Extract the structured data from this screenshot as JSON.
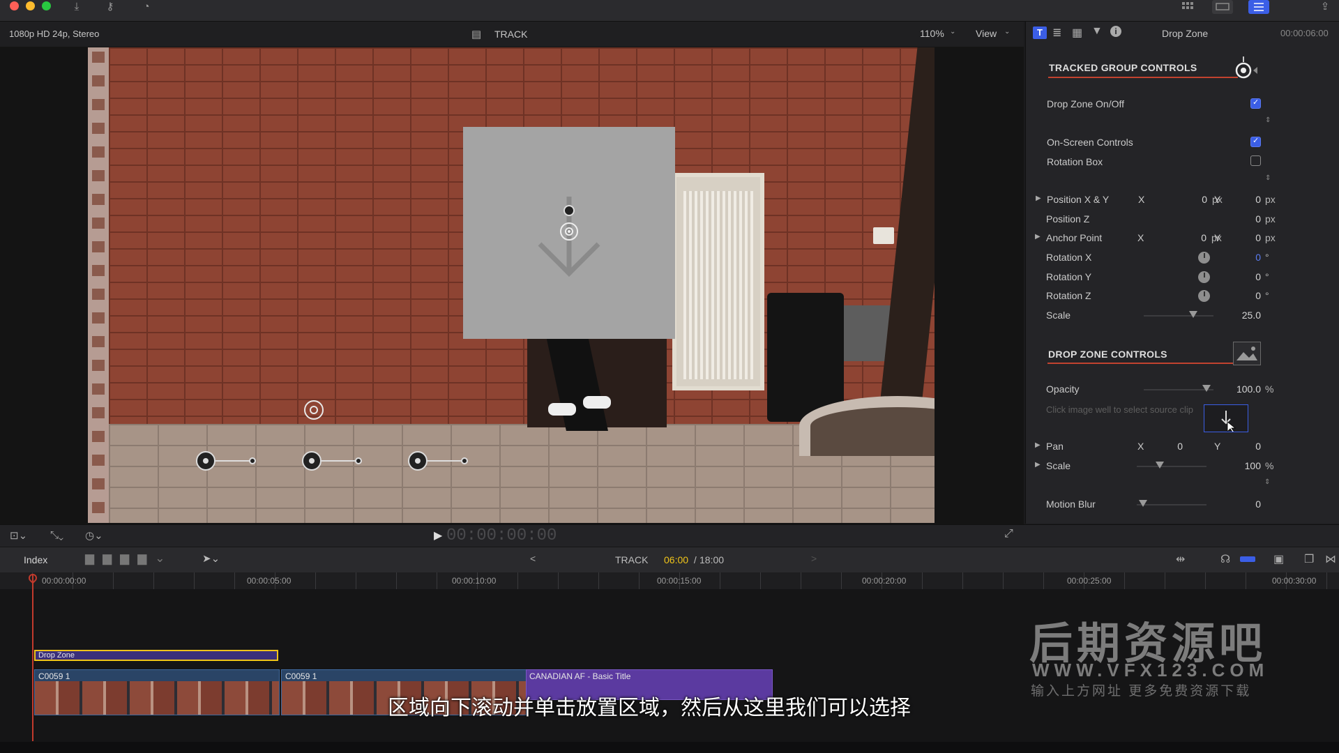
{
  "window": {
    "format_info": "1080p HD 24p, Stereo",
    "project_title": "TRACK",
    "zoom": "110%",
    "view_label": "View"
  },
  "inspector": {
    "title": "Drop Zone",
    "timecode": "00:00:06:00",
    "sections": {
      "tracked_group": "TRACKED GROUP CONTROLS",
      "drop_zone": "DROP ZONE CONTROLS"
    },
    "drop_zone_on_off": {
      "label": "Drop Zone On/Off",
      "checked": true
    },
    "on_screen_controls": {
      "label": "On-Screen Controls",
      "checked": true
    },
    "rotation_box": {
      "label": "Rotation Box",
      "checked": false
    },
    "position_xy": {
      "label": "Position X & Y",
      "x_label": "X",
      "x": "0",
      "x_unit": "px",
      "y_label": "Y",
      "y": "0",
      "y_unit": "px"
    },
    "position_z": {
      "label": "Position Z",
      "value": "0",
      "unit": "px"
    },
    "anchor_point": {
      "label": "Anchor Point",
      "x_label": "X",
      "x": "0",
      "x_unit": "px",
      "y_label": "Y",
      "y": "0",
      "y_unit": "px"
    },
    "rotation_x": {
      "label": "Rotation X",
      "value": "0",
      "unit": "°"
    },
    "rotation_y": {
      "label": "Rotation Y",
      "value": "0",
      "unit": "°"
    },
    "rotation_z": {
      "label": "Rotation Z",
      "value": "0",
      "unit": "°"
    },
    "scale": {
      "label": "Scale",
      "value": "25.0"
    },
    "opacity": {
      "label": "Opacity",
      "value": "100.0",
      "unit": "%"
    },
    "image_well_hint": "Click image well to select source clip",
    "pan": {
      "label": "Pan",
      "x_label": "X",
      "x": "0",
      "y_label": "Y",
      "y": "0"
    },
    "dz_scale": {
      "label": "Scale",
      "value": "100",
      "unit": "%"
    },
    "motion_blur": {
      "label": "Motion Blur",
      "value": "0"
    }
  },
  "viewer": {
    "playhead_timecode": "00:00:00:00"
  },
  "timeline": {
    "index_label": "Index",
    "project": "TRACK",
    "current": "06:00",
    "separator": " / ",
    "total": "18:00",
    "ruler": [
      "00:00:00:00",
      "00:00:05:00",
      "00:00:10:00",
      "00:00:15:00",
      "00:00:20:00",
      "00:00:25:00",
      "00:00:30:00"
    ],
    "clips": {
      "drop_zone": "Drop Zone",
      "c1": "C0059 1",
      "c2": "C0059 1",
      "title": "CANADIAN AF - Basic Title"
    }
  },
  "overlay": {
    "watermark_title": "后期资源吧",
    "watermark_url": "WWW.VFX123.COM",
    "watermark_sub": "输入上方网址 更多免费资源下载",
    "subtitle": "区域向下滚动并单击放置区域，然后从这里我们可以选择"
  },
  "colors": {
    "accent_blue": "#3b5ee6",
    "section_underline": "#c2432f",
    "playhead_time": "#f0c419",
    "title_clip": "#5b3aa0",
    "drop_zone_border": "#f0c419"
  },
  "icons": [
    "download-icon",
    "key-icon",
    "circle-clock-icon",
    "grid-icon",
    "layout-icon",
    "sliders-icon",
    "share-icon",
    "film-icon",
    "info-icon",
    "target-icon",
    "image-icon",
    "arrow-down-icon",
    "play-icon",
    "fullscreen-icon",
    "headphones-icon"
  ]
}
